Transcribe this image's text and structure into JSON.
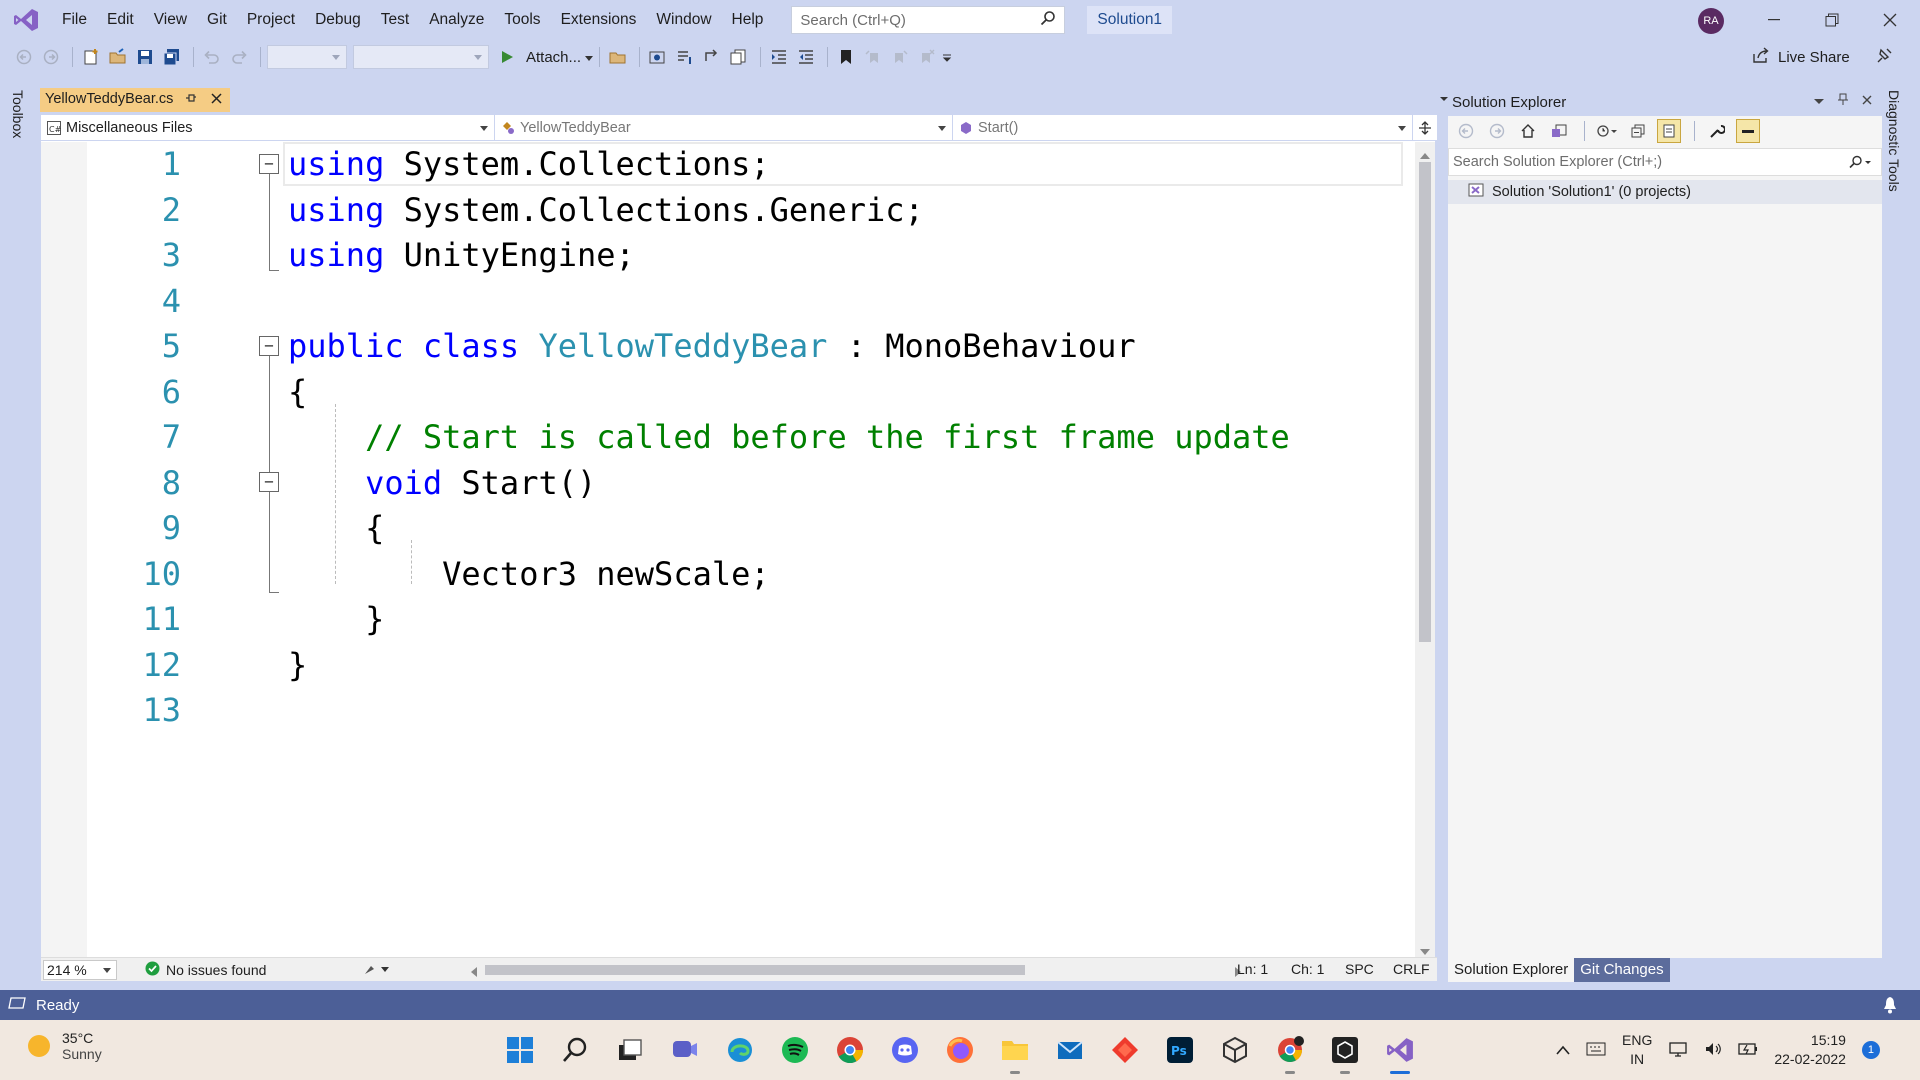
{
  "menu": {
    "items": [
      "File",
      "Edit",
      "View",
      "Git",
      "Project",
      "Debug",
      "Test",
      "Analyze",
      "Tools",
      "Extensions",
      "Window",
      "Help"
    ],
    "search_placeholder": "Search (Ctrl+Q)",
    "solution_name": "Solution1",
    "avatar_initials": "RA"
  },
  "toolbar": {
    "attach_label": "Attach...",
    "live_share_label": "Live Share"
  },
  "side_tabs": {
    "toolbox": "Toolbox",
    "diagnostic": "Diagnostic Tools"
  },
  "document_tab": {
    "title": "YellowTeddyBear.cs"
  },
  "navbar": {
    "project": "Miscellaneous Files",
    "type": "YellowTeddyBear",
    "member": "Start()"
  },
  "code": {
    "line_numbers": [
      "1",
      "2",
      "3",
      "4",
      "5",
      "6",
      "7",
      "8",
      "9",
      "10",
      "11",
      "12",
      "13"
    ],
    "lines": [
      [
        {
          "t": "using",
          "c": "kw"
        },
        {
          "t": " System.Collections;",
          "c": "pl"
        }
      ],
      [
        {
          "t": "using",
          "c": "kw"
        },
        {
          "t": " System.Collections.Generic;",
          "c": "pl"
        }
      ],
      [
        {
          "t": "using",
          "c": "kw"
        },
        {
          "t": " UnityEngine;",
          "c": "pl"
        }
      ],
      [],
      [
        {
          "t": "public",
          "c": "kw"
        },
        {
          "t": " ",
          "c": "pl"
        },
        {
          "t": "class",
          "c": "kw"
        },
        {
          "t": " ",
          "c": "pl"
        },
        {
          "t": "YellowTeddyBear",
          "c": "ty"
        },
        {
          "t": " : MonoBehaviour",
          "c": "pl"
        }
      ],
      [
        {
          "t": "{",
          "c": "pl"
        }
      ],
      [
        {
          "t": "    // Start is called before the first frame update",
          "c": "cm"
        }
      ],
      [
        {
          "t": "    ",
          "c": "pl"
        },
        {
          "t": "void",
          "c": "kw"
        },
        {
          "t": " Start()",
          "c": "pl"
        }
      ],
      [
        {
          "t": "    {",
          "c": "pl"
        }
      ],
      [
        {
          "t": "        Vector3 newScale;",
          "c": "pl"
        }
      ],
      [
        {
          "t": "    }",
          "c": "pl"
        }
      ],
      [
        {
          "t": "}",
          "c": "pl"
        }
      ],
      []
    ]
  },
  "editor_status": {
    "zoom": "214 %",
    "issues": "No issues found",
    "line": "Ln: 1",
    "char": "Ch: 1",
    "whitespace": "SPC",
    "line_ending": "CRLF"
  },
  "solution_explorer": {
    "title": "Solution Explorer",
    "search_placeholder": "Search Solution Explorer (Ctrl+;)",
    "tree_item": "Solution 'Solution1' (0 projects)",
    "tabs": [
      "Solution Explorer",
      "Git Changes"
    ]
  },
  "statusbar": {
    "text": "Ready"
  },
  "taskbar": {
    "temperature": "35°C",
    "weather": "Sunny",
    "lang_1": "ENG",
    "lang_2": "IN",
    "time": "15:19",
    "date": "22-02-2022",
    "notification_count": "1"
  },
  "colors": {
    "chrome": "#ccd5f0",
    "accent_tab": "#f5cc84",
    "status_bar": "#4c5f97",
    "keyword": "#0000ff",
    "type": "#2b91af",
    "comment": "#008000"
  }
}
